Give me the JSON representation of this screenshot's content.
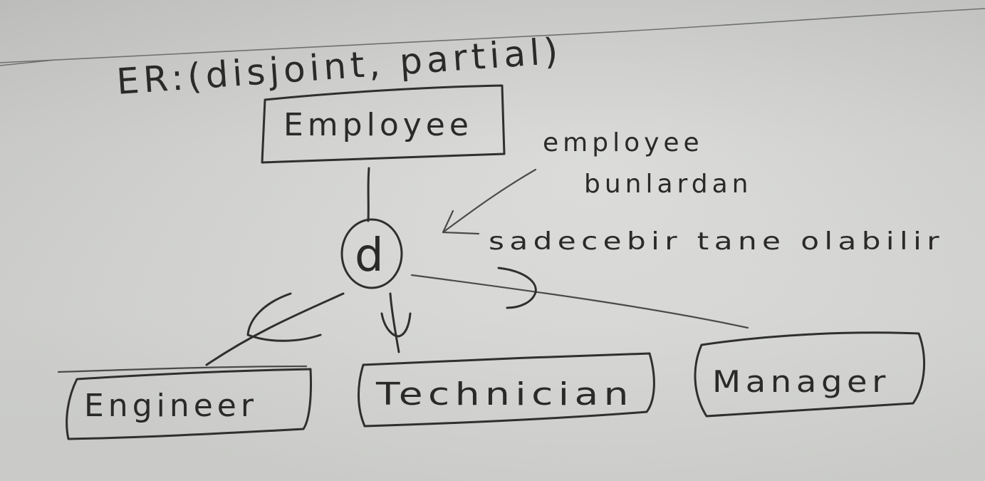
{
  "header": {
    "title": "ER:(disjoint, partial)"
  },
  "entities": {
    "superclass": "Employee",
    "constraint_symbol": "d",
    "subclasses": [
      "Engineer",
      "Technician",
      "Manager"
    ]
  },
  "note": {
    "lines": [
      "employee",
      "bunlardan",
      "sadecebir tane olabilir"
    ]
  },
  "colors": {
    "ink": "#2f2f2f",
    "paper": "#d3d4d1"
  }
}
